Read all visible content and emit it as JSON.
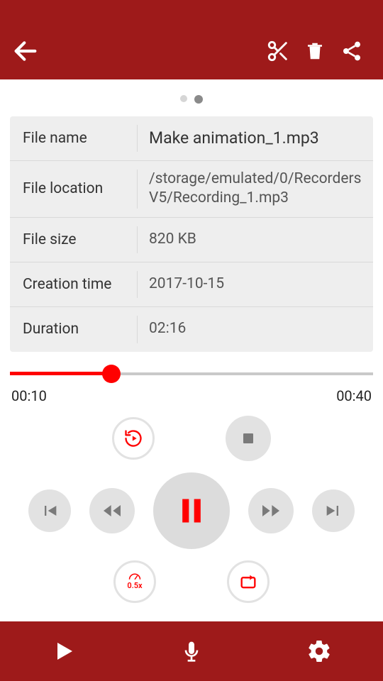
{
  "info": {
    "file_name_label": "File name",
    "file_name_value": "Make animation_1.mp3",
    "file_location_label": "File location",
    "file_location_value": "/storage/emulated/0/RecordersV5/Recording_1.mp3",
    "file_size_label": "File size",
    "file_size_value": "820 KB",
    "creation_time_label": "Creation time",
    "creation_time_value": "2017-10-15",
    "duration_label": "Duration",
    "duration_value": "02:16"
  },
  "playback": {
    "current": "00:10",
    "total": "00:40",
    "progress_percent": 28
  },
  "speed_label": "0.5x",
  "colors": {
    "brand": "#9e1a1a",
    "accent": "#ff0000"
  }
}
